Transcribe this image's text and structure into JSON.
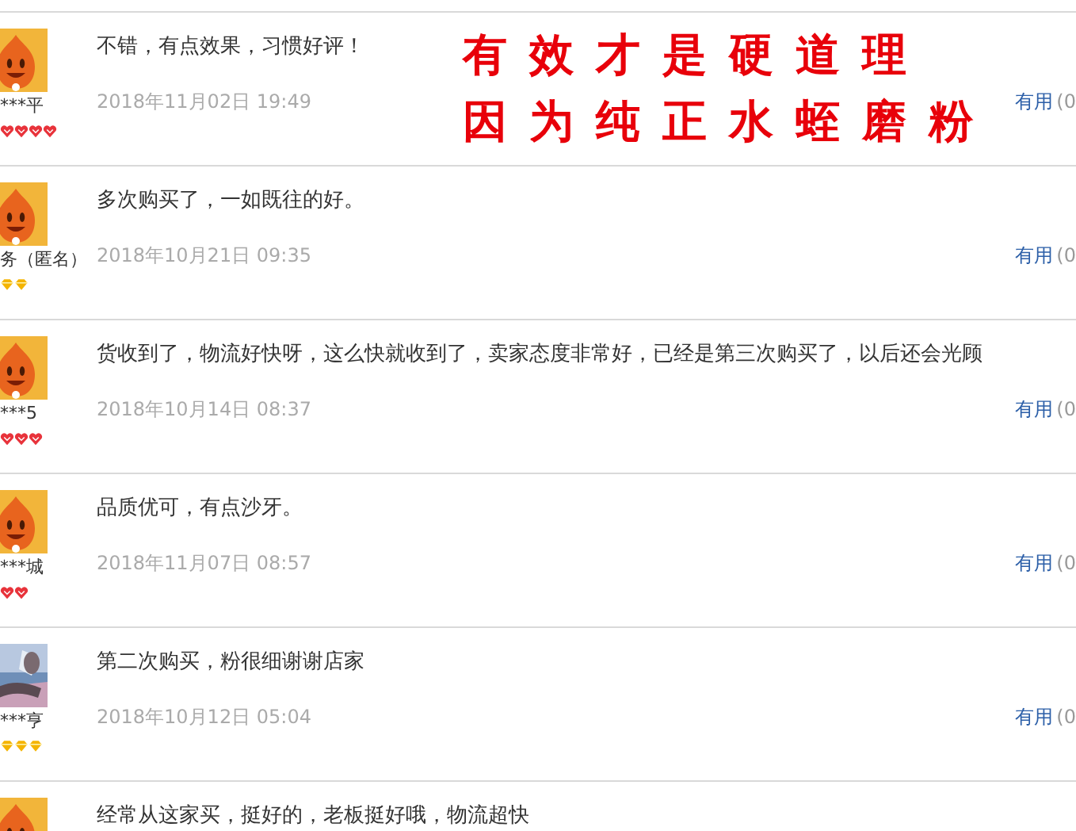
{
  "reviews": [
    {
      "avatar": {
        "kind": "mascot"
      },
      "user": "***平",
      "rank_icons": [
        {
          "kind": "heart"
        },
        {
          "kind": "heart"
        },
        {
          "kind": "heart"
        },
        {
          "kind": "heart"
        }
      ],
      "comment": "不错，有点效果，习惯好评！",
      "date": "2018年11月02日 19:49",
      "useful": "有用",
      "useful_count": "(0"
    },
    {
      "avatar": {
        "kind": "mascot"
      },
      "user": "务（匿名）",
      "rank_icons": [
        {
          "kind": "diamond"
        },
        {
          "kind": "diamond"
        }
      ],
      "comment": "多次购买了，一如既往的好。",
      "date": "2018年10月21日 09:35",
      "useful": "有用",
      "useful_count": "(0"
    },
    {
      "avatar": {
        "kind": "mascot"
      },
      "user": "***5",
      "rank_icons": [
        {
          "kind": "heart"
        },
        {
          "kind": "heart"
        },
        {
          "kind": "heart"
        }
      ],
      "comment": "货收到了，物流好快呀，这么快就收到了，卖家态度非常好，已经是第三次购买了，以后还会光顾",
      "date": "2018年10月14日 08:37",
      "useful": "有用",
      "useful_count": "(0"
    },
    {
      "avatar": {
        "kind": "mascot"
      },
      "user": "***城",
      "rank_icons": [
        {
          "kind": "heart"
        },
        {
          "kind": "heart"
        }
      ],
      "comment": "品质优可，有点沙牙。",
      "date": "2018年11月07日 08:57",
      "useful": "有用",
      "useful_count": "(0"
    },
    {
      "avatar": {
        "kind": "picture"
      },
      "user": "***亨",
      "rank_icons": [
        {
          "kind": "diamond"
        },
        {
          "kind": "diamond"
        },
        {
          "kind": "diamond"
        }
      ],
      "comment": "第二次购买，粉很细谢谢店家",
      "date": "2018年10月12日 05:04",
      "useful": "有用",
      "useful_count": "(0"
    },
    {
      "avatar": {
        "kind": "mascot"
      },
      "comment": "经常从这家买，挺好的，老板挺好哦，物流超快"
    }
  ],
  "promo_overlay": [
    "有效才是硬道理",
    "因为纯正水蛭磨粉"
  ]
}
